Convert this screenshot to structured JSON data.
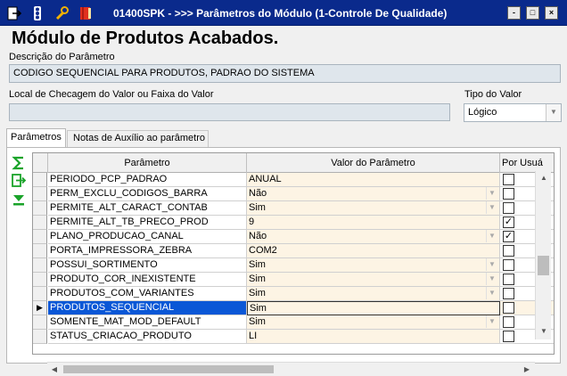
{
  "window": {
    "title": "01400SPK - >>> Parâmetros do Módulo (1-Controle De Qualidade)",
    "minimize": "-",
    "maximize": "□",
    "close": "×"
  },
  "page_title": "Módulo de Produtos Acabados.",
  "descricao": {
    "label": "Descrição do Parâmetro",
    "value": "CODIGO SEQUENCIAL PARA PRODUTOS, PADRAO DO SISTEMA"
  },
  "local": {
    "label": "Local de Checagem do Valor ou Faixa do Valor",
    "value": ""
  },
  "tipo": {
    "label": "Tipo do Valor",
    "value": "Lógico"
  },
  "tabs": [
    {
      "label": "Parâmetros",
      "active": true
    },
    {
      "label": "Notas de Auxílio ao parâmetro",
      "active": false
    }
  ],
  "grid": {
    "columns": [
      "Parâmetro",
      "Valor do Parâmetro",
      "Por Usuá"
    ],
    "rows": [
      {
        "param": "PERIODO_PCP_PADRAO",
        "value": "ANUAL",
        "dropdown": false,
        "checked": false
      },
      {
        "param": "PERM_EXCLU_CODIGOS_BARRA",
        "value": "Não",
        "dropdown": true,
        "checked": false
      },
      {
        "param": "PERMITE_ALT_CARACT_CONTAB",
        "value": "Sim",
        "dropdown": true,
        "checked": false
      },
      {
        "param": "PERMITE_ALT_TB_PRECO_PROD",
        "value": "9",
        "dropdown": false,
        "checked": true
      },
      {
        "param": "PLANO_PRODUCAO_CANAL",
        "value": "Não",
        "dropdown": true,
        "checked": true
      },
      {
        "param": "PORTA_IMPRESSORA_ZEBRA",
        "value": "COM2",
        "dropdown": false,
        "checked": false
      },
      {
        "param": "POSSUI_SORTIMENTO",
        "value": "Sim",
        "dropdown": true,
        "checked": false
      },
      {
        "param": "PRODUTO_COR_INEXISTENTE",
        "value": "Sim",
        "dropdown": true,
        "checked": false
      },
      {
        "param": "PRODUTOS_COM_VARIANTES",
        "value": "Sim",
        "dropdown": true,
        "checked": false
      },
      {
        "param": "PRODUTOS_SEQUENCIAL",
        "value": "Sim",
        "dropdown": false,
        "checked": false,
        "selected": true
      },
      {
        "param": "SOMENTE_MAT_MOD_DEFAULT",
        "value": "Sim",
        "dropdown": true,
        "checked": false
      },
      {
        "param": "STATUS_CRIACAO_PRODUTO",
        "value": "LI",
        "dropdown": false,
        "checked": false
      }
    ]
  },
  "icons": {
    "toolbar": [
      "exit-icon",
      "traffic-light-icon",
      "wrench-icon",
      "book-icon"
    ],
    "side": [
      "sigma-icon",
      "export-icon",
      "filter-icon"
    ]
  },
  "colors": {
    "title_bar": "#0a2a8c",
    "selected_row": "#0a57d6",
    "row_value_bg": "#fdf4e4",
    "side_icons": "#1aa32a"
  }
}
